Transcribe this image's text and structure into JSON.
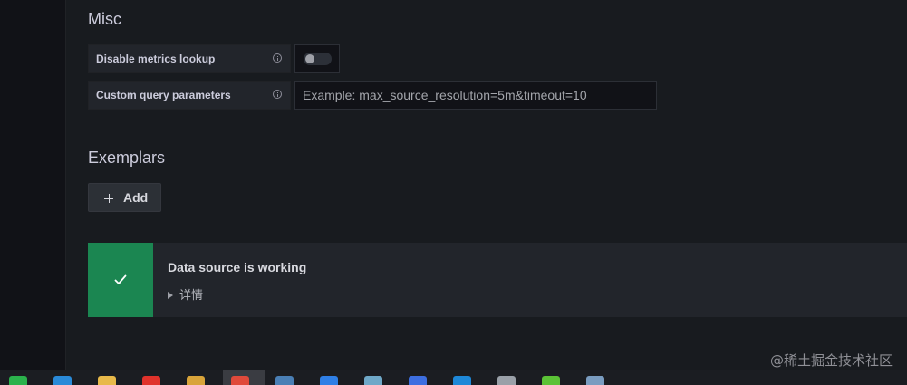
{
  "misc": {
    "title": "Misc",
    "disable_metrics_lookup": {
      "label": "Disable metrics lookup",
      "enabled": false
    },
    "custom_query_parameters": {
      "label": "Custom query parameters",
      "placeholder": "Example: max_source_resolution=5m&timeout=10",
      "value": ""
    }
  },
  "exemplars": {
    "title": "Exemplars",
    "add_label": "Add"
  },
  "status": {
    "title": "Data source is working",
    "details_label": "详情",
    "color": "#1b8651"
  },
  "watermark": "@稀土掘金技术社区",
  "taskbar": {
    "icons": [
      {
        "name": "wechat-icon",
        "color": "#2bb24c"
      },
      {
        "name": "vscode-icon",
        "color": "#2a8ad8"
      },
      {
        "name": "folder-icon",
        "color": "#e8b94a"
      },
      {
        "name": "xmind-icon",
        "color": "#e0322b"
      },
      {
        "name": "app-icon",
        "color": "#d9a43a"
      },
      {
        "name": "chrome-icon",
        "color": "#e04a3b"
      },
      {
        "name": "monitor-icon",
        "color": "#4a7fb5"
      },
      {
        "name": "upload-icon",
        "color": "#2f7fe6"
      },
      {
        "name": "note-icon",
        "color": "#6fa8c8"
      },
      {
        "name": "chat-icon",
        "color": "#3d6ee0"
      },
      {
        "name": "mail-icon",
        "color": "#1e88d8"
      },
      {
        "name": "photo-icon",
        "color": "#9aa0a8"
      },
      {
        "name": "green-app-icon",
        "color": "#5bc236"
      },
      {
        "name": "window-icon",
        "color": "#7a9cc0"
      }
    ]
  }
}
